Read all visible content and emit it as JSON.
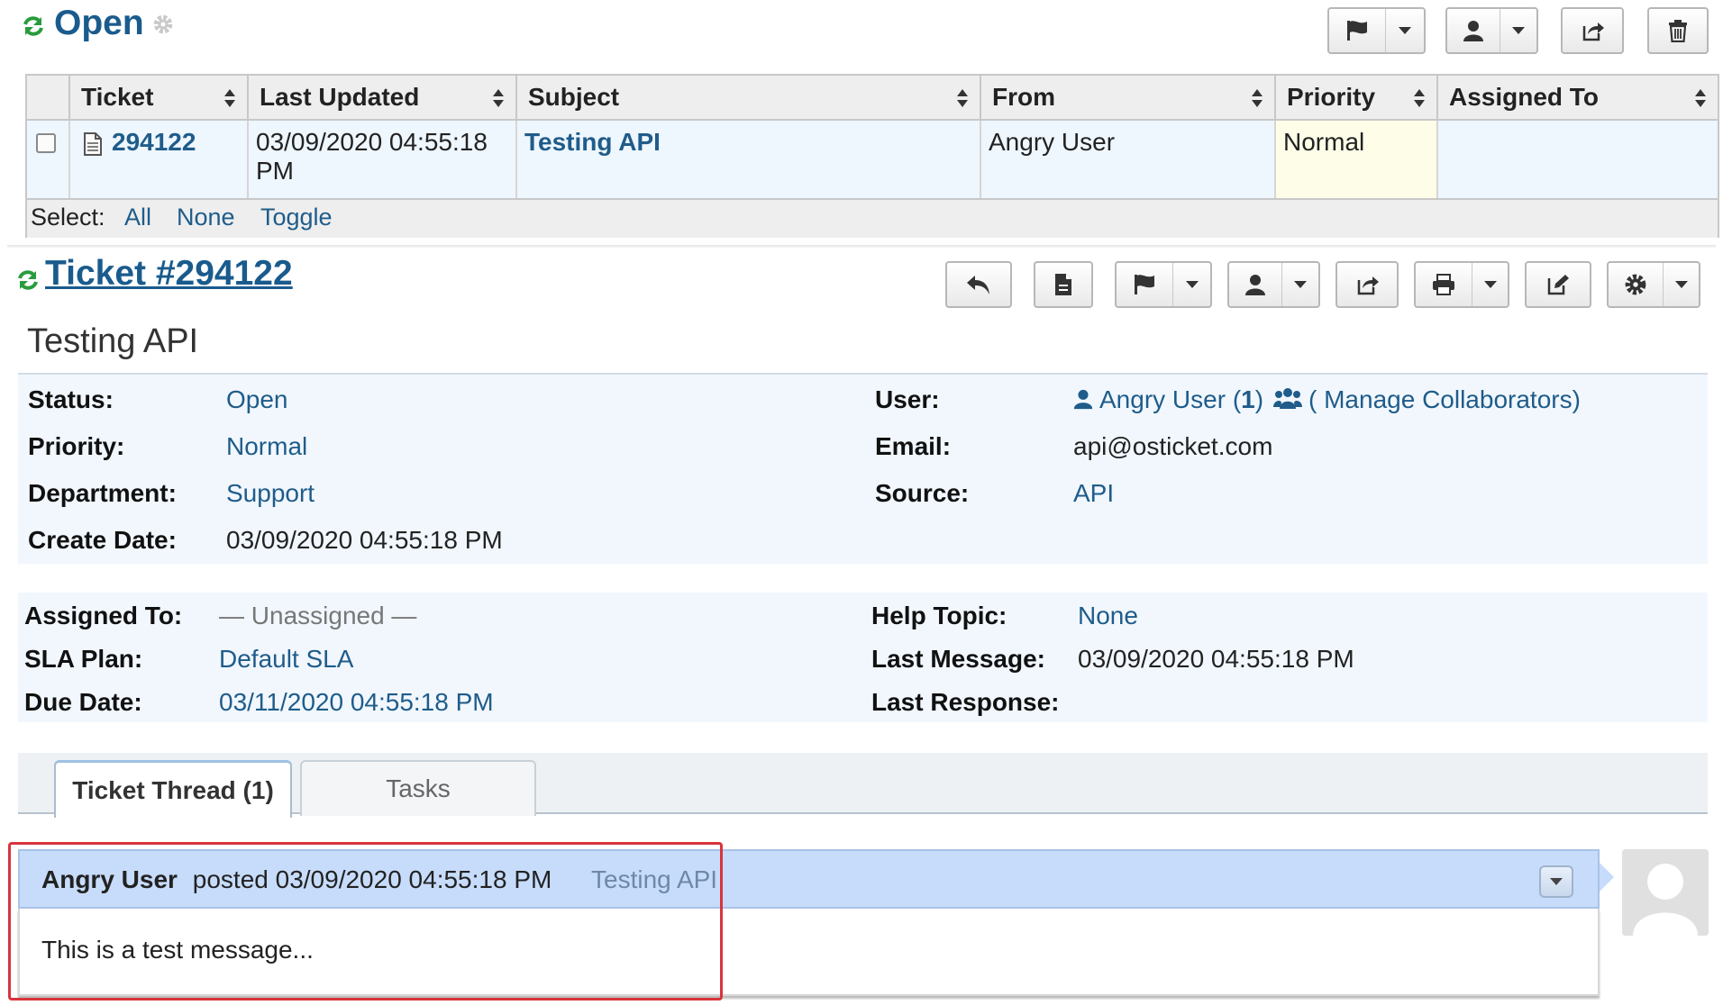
{
  "queue": {
    "title": "Open",
    "columns": [
      "Ticket",
      "Last Updated",
      "Subject",
      "From",
      "Priority",
      "Assigned To"
    ],
    "rows": [
      {
        "ticket": "294122",
        "last_updated_line1": "03/09/2020 04:55:18",
        "last_updated_line2": "PM",
        "subject": "Testing API",
        "from": "Angry User",
        "priority": "Normal",
        "assigned_to": ""
      }
    ],
    "select_label": "Select:",
    "select_all": "All",
    "select_none": "None",
    "select_toggle": "Toggle"
  },
  "ticket": {
    "heading": " Ticket #294122",
    "subject": "Testing API",
    "fields_left": [
      {
        "label": "Status:",
        "value": "Open"
      },
      {
        "label": "Priority:",
        "value": "Normal"
      },
      {
        "label": "Department:",
        "value": "Support"
      },
      {
        "label": "Create Date:",
        "value": "03/09/2020 04:55:18 PM"
      }
    ],
    "user_label": "User:",
    "user_name": "Angry User (",
    "user_count": "1",
    "user_close": ")",
    "manage_collaborators": "( Manage Collaborators)",
    "email_label": "Email:",
    "email_value": "api@osticket.com",
    "source_label": "Source:",
    "source_value": "API",
    "assigned_label": "Assigned To:",
    "assigned_value": "— Unassigned —",
    "sla_label": "SLA Plan:",
    "sla_value": "Default SLA",
    "due_label": "Due Date:",
    "due_value": "03/11/2020 04:55:18 PM",
    "help_topic_label": "Help Topic:",
    "help_topic_value": "None",
    "last_message_label": "Last Message:",
    "last_message_value": "03/09/2020 04:55:18 PM",
    "last_response_label": "Last Response:",
    "last_response_value": ""
  },
  "tabs": [
    {
      "label": "Ticket Thread (1)",
      "active": true
    },
    {
      "label": "Tasks",
      "active": false
    }
  ],
  "thread": {
    "author": "Angry User",
    "posted_text": " posted 03/09/2020 04:55:18 PM",
    "title": "Testing API",
    "body": "This is a test message..."
  },
  "colors": {
    "link": "#1f5c8a",
    "refresh_green": "#2a9b3c",
    "thread_header": "#c7dcfb",
    "highlight_red": "#d9343c",
    "panel_bg": "#f1f7fd",
    "priority_bg": "#fdfde8"
  },
  "icons": [
    "refresh-icon",
    "gear-icon",
    "flag-icon",
    "user-icon",
    "share-icon",
    "trash-icon",
    "reply-icon",
    "note-icon",
    "print-icon",
    "edit-icon",
    "caret-down-icon",
    "sort-icon",
    "document-icon",
    "users-icon",
    "avatar-icon"
  ]
}
